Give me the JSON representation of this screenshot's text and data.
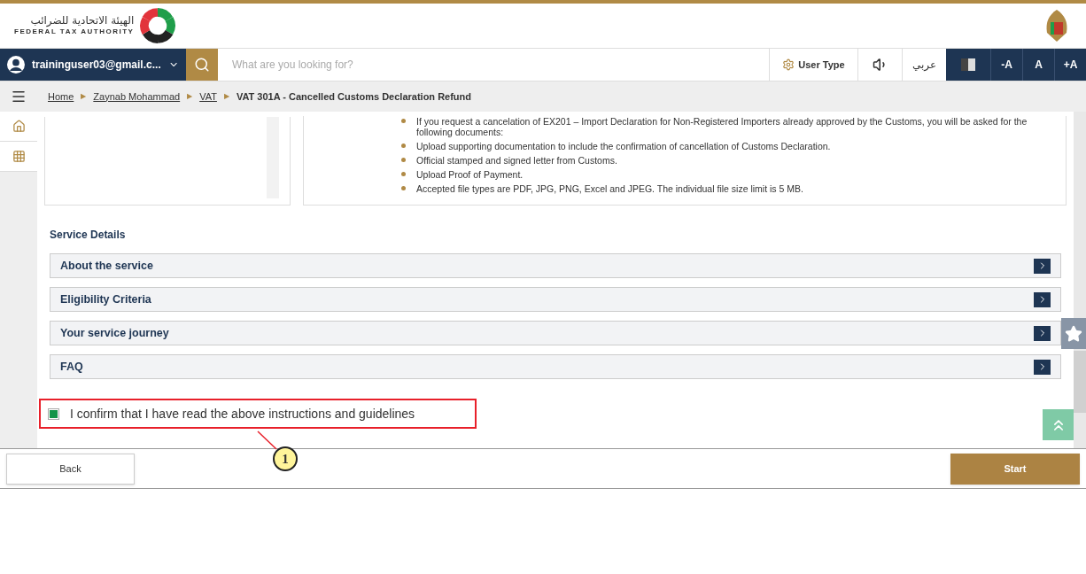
{
  "header": {
    "logo_arabic": "الهيئة الاتحادية للضرائب",
    "logo_english": "FEDERAL TAX AUTHORITY"
  },
  "navbar": {
    "user": "traininguser03@gmail.c...",
    "search": {
      "placeholder": "What are you looking for?"
    },
    "user_type": "User Type",
    "language": "عربي",
    "font_buttons": [
      "-A",
      "A",
      "+A"
    ]
  },
  "breadcrumb_separator": "▶",
  "breadcrumb": [
    {
      "label": "Home",
      "link": true
    },
    {
      "label": "Zaynab Mohammad",
      "link": true
    },
    {
      "label": "VAT",
      "link": true
    },
    {
      "label": "VAT 301A - Cancelled Customs Declaration Refund",
      "link": false
    }
  ],
  "instructions": [
    "If you request a cancelation of EX201 – Import Declaration for Non-Registered Importers already approved by the Customs, you will be asked for the following documents:",
    "Upload supporting documentation to include the confirmation of cancellation of Customs Declaration.",
    "Official stamped and signed letter from Customs.",
    "Upload Proof of Payment.",
    "Accepted file types are PDF, JPG, PNG, Excel and JPEG. The individual file size limit is 5 MB."
  ],
  "service_details": {
    "title": "Service Details",
    "sections": [
      {
        "label": "About the service",
        "expanded": false
      },
      {
        "label": "Eligibility Criteria",
        "expanded": false
      },
      {
        "label": "Your service journey",
        "expanded": false
      },
      {
        "label": "FAQ",
        "expanded": false
      }
    ]
  },
  "confirm": {
    "label": "I confirm that I have read the above instructions and guidelines",
    "checked": true
  },
  "annotation": {
    "label": "1"
  },
  "footer": {
    "back": "Back",
    "start": "Start"
  }
}
